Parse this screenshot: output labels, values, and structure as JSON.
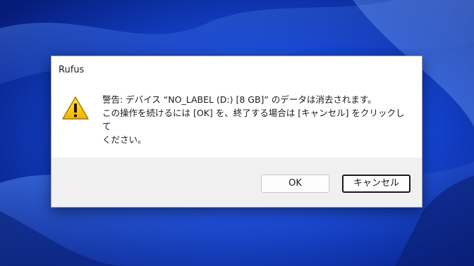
{
  "window": {
    "title": "Rufus"
  },
  "message": {
    "line1": "警告: デバイス “NO_LABEL (D:) [8 GB]” のデータは消去されます。",
    "line2": "この操作を続けるには [OK] を、終了する場合は [キャンセル] をクリックして",
    "line3": "ください。"
  },
  "buttons": {
    "ok_label": "OK",
    "cancel_label": "キャンセル"
  },
  "icons": {
    "status": "warning-icon"
  },
  "colors": {
    "wallpaper_base": "#0a2a9e",
    "wallpaper_highlight": "#3b78ff",
    "warning_yellow": "#f5c400",
    "footer_bg": "#f0f0f0"
  }
}
